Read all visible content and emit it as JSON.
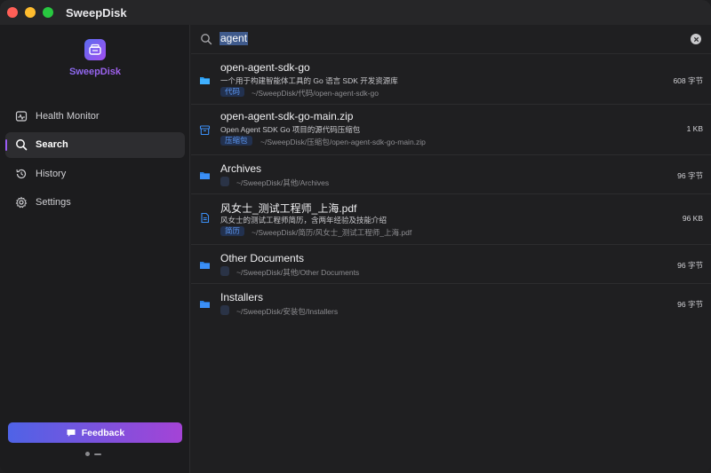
{
  "window": {
    "title": "SweepDisk"
  },
  "sidebar": {
    "brand": "SweepDisk",
    "items": [
      {
        "label": "Health Monitor",
        "icon": "heart-monitor-icon"
      },
      {
        "label": "Search",
        "icon": "search-icon",
        "active": true
      },
      {
        "label": "History",
        "icon": "history-icon"
      },
      {
        "label": "Settings",
        "icon": "gear-icon"
      }
    ],
    "feedback_label": "Feedback"
  },
  "search": {
    "query": "agent"
  },
  "results": [
    {
      "title": "open-agent-sdk-go",
      "desc": "一个用于构建智能体工具的 Go 语言 SDK 开发资源库",
      "tag": "代码",
      "path": "~/SweepDisk/代码/open-agent-sdk-go",
      "size": "608 字节",
      "icon": "folder-icon"
    },
    {
      "title": "open-agent-sdk-go-main.zip",
      "desc": "Open Agent SDK Go 项目的源代码压缩包",
      "tag": "压缩包",
      "path": "~/SweepDisk/压缩包/open-agent-sdk-go-main.zip",
      "size": "1 KB",
      "icon": "archive-icon"
    },
    {
      "title": "Archives",
      "desc": "",
      "tag": "",
      "path": "~/SweepDisk/其他/Archives",
      "size": "96 字节",
      "icon": "folder-icon"
    },
    {
      "title": "风女士_测试工程师_上海.pdf",
      "desc": "风女士的测试工程师简历，含两年经验及技能介绍",
      "tag": "简历",
      "path": "~/SweepDisk/简历/风女士_测试工程师_上海.pdf",
      "size": "96 KB",
      "icon": "document-icon"
    },
    {
      "title": "Other Documents",
      "desc": "",
      "tag": "",
      "path": "~/SweepDisk/其他/Other Documents",
      "size": "96 字节",
      "icon": "folder-icon"
    },
    {
      "title": "Installers",
      "desc": "",
      "tag": "",
      "path": "~/SweepDisk/安装包/Installers",
      "size": "96 字节",
      "icon": "folder-icon"
    }
  ],
  "colors": {
    "accent": "#9b5cf6",
    "folder": "#3b8ff6",
    "tag_bg": "#22314f",
    "tag_text": "#5b95ee"
  }
}
